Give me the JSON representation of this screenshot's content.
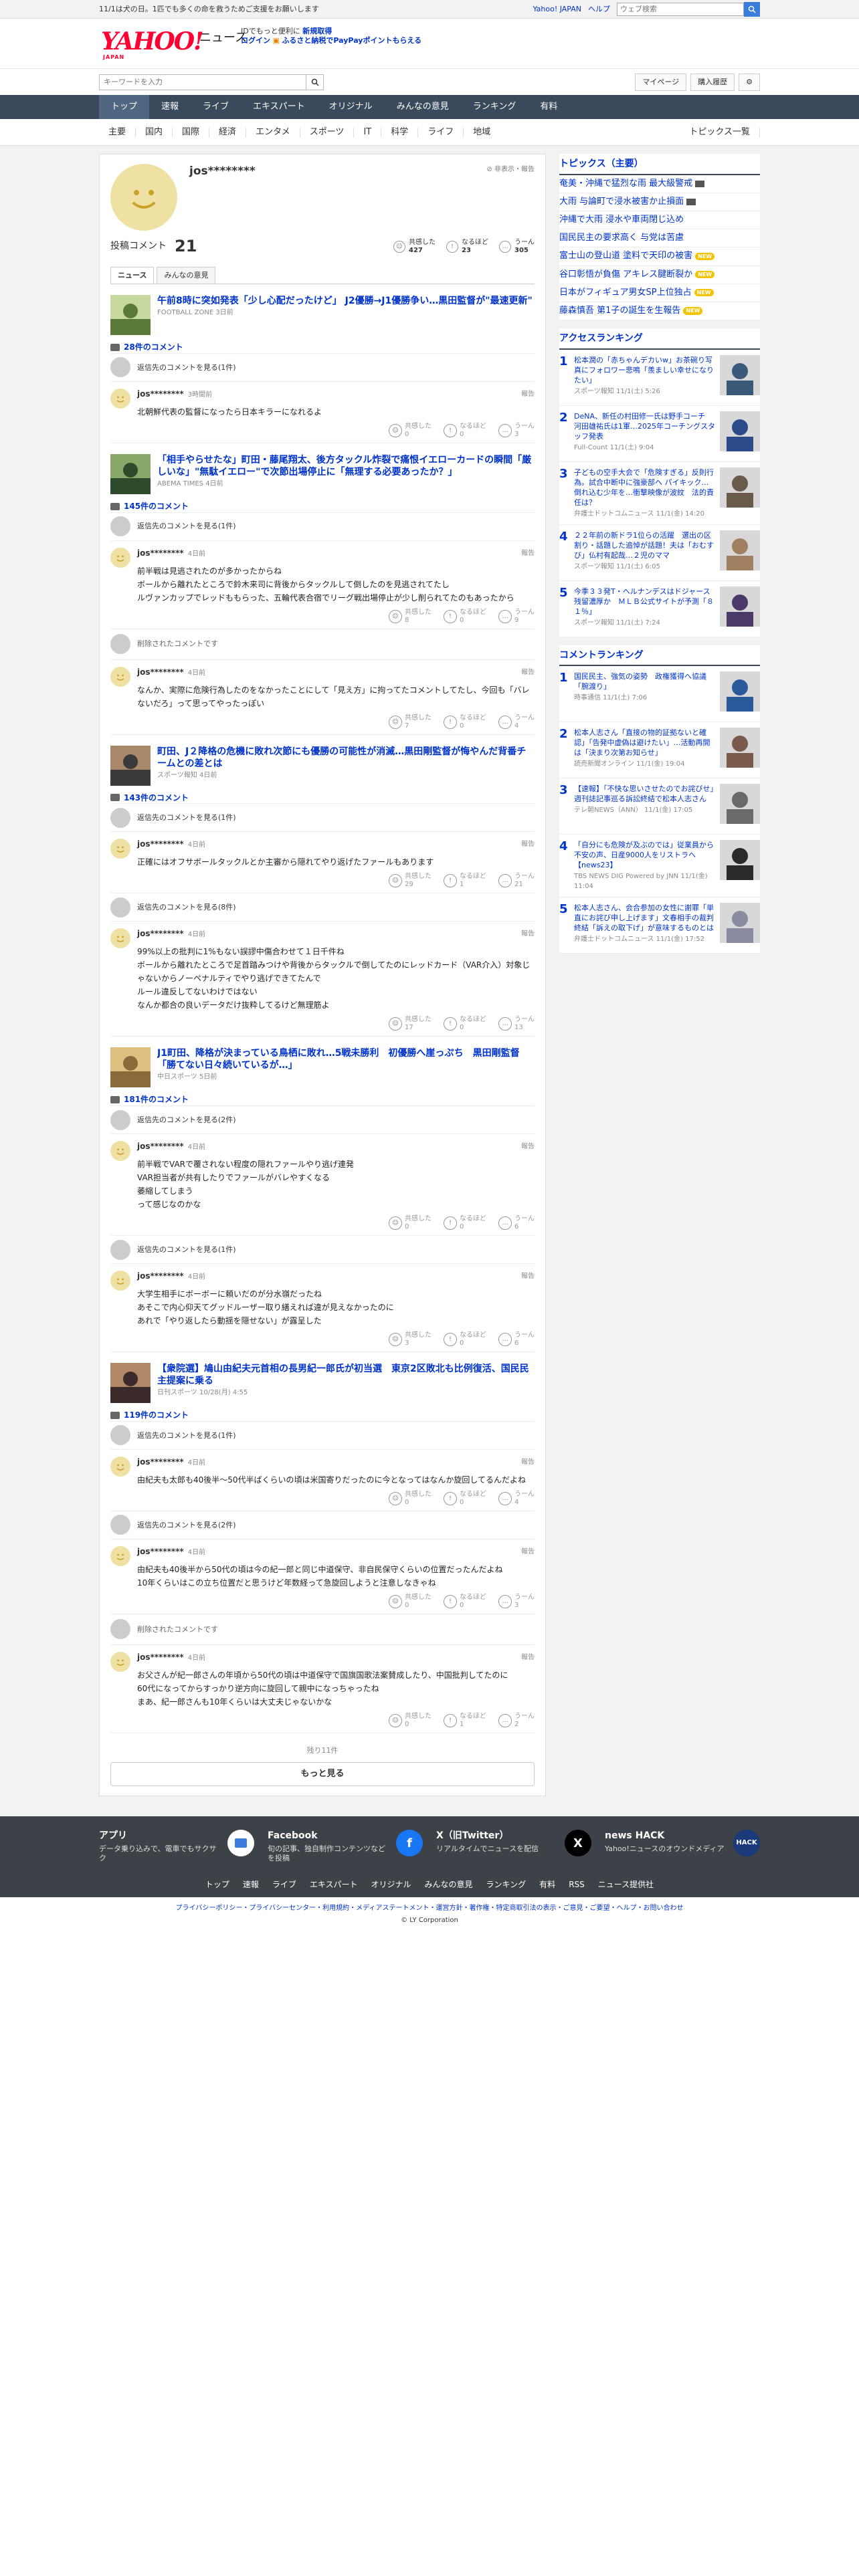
{
  "topbar": {
    "message": "11/1は犬の日。1匹でも多くの命を救うためご支援をお願いします",
    "links": [
      "Yahoo! JAPAN",
      "ヘルプ"
    ],
    "search_placeholder": "ウェブ検索"
  },
  "header": {
    "logo": "YAHOO!",
    "logo_sub": "JAPAN",
    "section": "ニュース",
    "promo_line1": "IDでもっと便利に",
    "promo_new": "新規取得",
    "promo_login": "ログイン",
    "promo_line2": "ふるさと納税でPayPayポイントもらえる",
    "search_placeholder": "キーワードを入力",
    "btn_mypage": "マイページ",
    "btn_purchase": "購入履歴"
  },
  "gnav": [
    "トップ",
    "速報",
    "ライブ",
    "エキスパート",
    "オリジナル",
    "みんなの意見",
    "ランキング",
    "有料"
  ],
  "snav": [
    "主要",
    "国内",
    "国際",
    "経済",
    "エンタメ",
    "スポーツ",
    "IT",
    "科学",
    "ライフ",
    "地域"
  ],
  "snav_right": "トピックス一覧",
  "profile": {
    "name": "jos********",
    "report": "非表示・報告",
    "count_label": "投稿コメント",
    "count": "21",
    "stats": [
      {
        "label": "共感した",
        "value": "427"
      },
      {
        "label": "なるほど",
        "value": "23"
      },
      {
        "label": "うーん",
        "value": "305"
      }
    ]
  },
  "tabs": [
    "ニュース",
    "みんなの意見"
  ],
  "reply_label": "返信先のコメントを見る(1件)",
  "deleted_label": "削除されたコメントです",
  "reactions": [
    "共感した",
    "なるほど",
    "うーん"
  ],
  "report_label": "報告",
  "articles": [
    {
      "title": "午前8時に突如発表「少し心配だったけど」 J2優勝→J1優勝争い…黒田監督が\"最速更新\"",
      "source": "FOOTBALL ZONE 3日前",
      "count": "28件のコメント",
      "reply": "返信先のコメントを見る(1件)",
      "comments": [
        {
          "user": "jos********",
          "time": "3時間前",
          "text": [
            "北朝鮮代表の監督になったら日本キラーになれるよ"
          ],
          "r": [
            "0",
            "0",
            "3"
          ]
        }
      ]
    },
    {
      "title": "「相手やらせたな」町田・藤尾翔太、後方タックル炸裂で痛恨イエローカードの瞬間「厳しいな」\"無駄イエロー\"で次節出場停止に「無理する必要あったか？」",
      "source": "ABEMA TIMES 4日前",
      "count": "145件のコメント",
      "reply": "返信先のコメントを見る(1件)",
      "comments": [
        {
          "user": "jos********",
          "time": "4日前",
          "text": [
            "前半戦は見逃されたのが多かったからね",
            "ボールから離れたところで鈴木来司に背後からタックルして倒したのを見逃されてたし",
            "ルヴァンカップでレッドももらった、五輪代表合宿でリーグ戦出場停止が少し削られてたのもあったから"
          ],
          "r": [
            "8",
            "0",
            "9"
          ],
          "deleted_before": false
        },
        {
          "user": "jos********",
          "time": "4日前",
          "text": [
            "なんか、実際に危険行為したのをなかったことにして「見え方」に拘ってたコメントしてたし、今回も「バレないだろ」って思ってやったっぽい"
          ],
          "r": [
            "7",
            "0",
            "4"
          ],
          "deleted_before": true
        }
      ]
    },
    {
      "title": "町田、J２降格の危機に敗れ次節にも優勝の可能性が消滅…黒田剛監督が悔やんだ背番チームとの差とは",
      "source": "スポーツ報知 4日前",
      "count": "143件のコメント",
      "reply": "返信先のコメントを見る(1件)",
      "comments": [
        {
          "user": "jos********",
          "time": "4日前",
          "text": [
            "正確にはオフサボールタックルとか主審から隠れてやり返げたファールもあります"
          ],
          "r": [
            "29",
            "1",
            "21"
          ]
        },
        {
          "user": "jos********",
          "time": "4日前",
          "reply_before": "返信先のコメントを見る(8件)",
          "text": [
            "99%以上の批判に1%もない誤謬中傷合わせて１日千件ね",
            "ボールから離れたところで足首踏みつけや背後からタックルで倒してたのにレッドカード（VAR介入）対象じゃないからノーペナルティでやり逃げできてたんで",
            "ルール違反してないわけではない",
            "なんか都合の良いデータだけ抜粋してるけど無理筋よ"
          ],
          "r": [
            "17",
            "0",
            "13"
          ]
        }
      ]
    },
    {
      "title": "J1町田、降格が決まっている鳥栖に敗れ…5戦未勝利　初優勝へ崖っぷち　黒田剛監督「勝てない日々続いているが…」",
      "source": "中日スポーツ 5日前",
      "count": "181件のコメント",
      "reply": "返信先のコメントを見る(2件)",
      "comments": [
        {
          "user": "jos********",
          "time": "4日前",
          "text": [
            "前半戦でVARで覆されない程度の隠れファールやり逃げ連発",
            "VAR担当者が共有したりでファールがバレやすくなる",
            "萎縮してしまう",
            "って感じなのかな"
          ],
          "r": [
            "0",
            "0",
            "6"
          ]
        },
        {
          "user": "jos********",
          "time": "4日前",
          "reply_before": "返信先のコメントを見る(1件)",
          "text": [
            "大学生相手にボーボーに頼いだのが分水嶺だったね",
            "あそこで内心仰天てグッドルーザー取り繕えれば違が見えなかったのに",
            "あれで「やり返したら動揺を隠せない」が露呈した"
          ],
          "r": [
            "3",
            "0",
            "6"
          ]
        }
      ]
    },
    {
      "title": "【衆院選】鳩山由紀夫元首相の長男紀一郎氏が初当選　東京2区敗北も比例復活、国民民主提案に乗る",
      "source": "日刊スポーツ 10/28(月) 4:55",
      "count": "119件のコメント",
      "reply": "返信先のコメントを見る(1件)",
      "comments": [
        {
          "user": "jos********",
          "time": "4日前",
          "text": [
            "由紀夫も太郎も40後半〜50代半ばくらいの頃は米国寄りだったのに今となってはなんか旋回してるんだよね"
          ],
          "r": [
            "0",
            "0",
            "4"
          ]
        },
        {
          "user": "jos********",
          "time": "4日前",
          "reply_before": "返信先のコメントを見る(2件)",
          "text": [
            "由紀夫も40後半から50代の頃は今の紀一郎と同じ中道保守、非自民保守くらいの位置だったんだよね",
            "10年くらいはこの立ち位置だと思うけど年数経って急旋回しようと注意しなきゃね"
          ],
          "r": [
            "0",
            "0",
            "3"
          ]
        },
        {
          "user": "jos********",
          "time": "4日前",
          "deleted_before": true,
          "text": [
            "お父さんが紀一郎さんの年頃から50代の頃は中道保守で国旗国歌法案賛成したり、中国批判してたのに",
            "60代になってからすっかり逆方向に旋回して親中になっちゃったね",
            "まあ、紀一郎さんも10年くらいは大丈夫じゃないかな"
          ],
          "r": [
            "0",
            "1",
            "2"
          ]
        }
      ]
    }
  ],
  "more": {
    "remaining": "残り11件",
    "button": "もっと見る"
  },
  "sidebar": {
    "topics_title": "トピックス（主要）",
    "topics": [
      {
        "t": "奄美・沖縄で猛烈な雨 最大級警戒",
        "b": "icon"
      },
      {
        "t": "大雨 与論町で浸水被害か止損面",
        "b": "icon"
      },
      {
        "t": "沖縄で大雨 浸水や車両閉じ込め",
        "b": ""
      },
      {
        "t": "国民民主の要求高く 与党は苦慮",
        "b": ""
      },
      {
        "t": "富士山の登山道 塗料で天印の被害",
        "b": "NEW"
      },
      {
        "t": "谷口彰悟が負傷 アキレス腱断裂か",
        "b": "NEW"
      },
      {
        "t": "日本がフィギュア男女SP上位独占",
        "b": "NEW"
      },
      {
        "t": "藤森慎吾 第1子の誕生を生報告",
        "b": "NEW"
      }
    ],
    "access_title": "アクセスランキング",
    "access": [
      {
        "t": "松本潤の「赤ちゃんデカいw」お茶碗り写真にフォロワー悲鳴「羨ましい幸せになりたい」",
        "s": "スポーツ報知 11/1(土) 5:26"
      },
      {
        "t": "DeNA、新任の村田修一氏は野手コーチ　河田雄祐氏は1軍…2025年コーチングスタッフ発表",
        "s": "Full-Count 11/1(土) 9:04"
      },
      {
        "t": "子どもの空手大会で「危険すぎる」反則行為。試合中断中に強豪部へ パイキック…倒れ込む少年を…衝撃映像が波紋　法的責任は？",
        "s": "弁護士ドットコムニュース 11/1(金) 14:20"
      },
      {
        "t": "２２年前の新ドラ1位らの活躍　選出の区割り・話題した追悼が話題！夫は「おむすび」仏村有起哉…２児のママ",
        "s": "スポーツ報知 11/1(土) 6:05"
      },
      {
        "t": "今季３３発T・ヘルナンデスはドジャース残留濃厚か　ＭＬＢ公式サイトが予測「８１％」",
        "s": "スポーツ報知 11/1(土) 7:24"
      }
    ],
    "comment_title": "コメントランキング",
    "comment_rank": [
      {
        "t": "国民民主、強気の姿勢　政権獲得へ協議「腕渡り」",
        "s": "時事通信 11/1(土) 7:06"
      },
      {
        "t": "松本人志さん「直接の物的証拠ないと確認」「告発中虚偽は避けたい」…活動再開は「決まり次第お知らせ」",
        "s": "読売新聞オンライン 11/1(金) 19:04"
      },
      {
        "t": "【速報】「不快な思いさせたのでお詫びせ」週刊誌記事巡る訴訟終結で松本人志さん",
        "s": "テレ朝NEWS（ANN） 11/1(金) 17:05"
      },
      {
        "t": "「自分にも危険が及ぶのでは」従業員から不安の声、日産9000人をリストラへ【news23】",
        "s": "TBS NEWS DIG Powered by JNN 11/1(金) 11:04"
      },
      {
        "t": "松本人志さん、会合参加の女性に謝罪「単直にお詫び申し上げます」文春相手の裁判終結「訴えの取下げ」が意味するものとは",
        "s": "弁護士ドットコムニュース 11/1(金) 17:52"
      }
    ]
  },
  "footer": {
    "cols": [
      {
        "title": "アプリ",
        "desc": "データ乗り込みで、電車でもサクサク",
        "icon": "app-icon"
      },
      {
        "title": "Facebook",
        "desc": "旬の記事、独自制作コンテンツなどを投稿",
        "icon": "f"
      },
      {
        "title": "X（旧Twitter）",
        "desc": "リアルタイムでニュースを配信",
        "icon": "X"
      },
      {
        "title": "news HACK",
        "desc": "Yahoo!ニュースのオウンドメディア",
        "icon": "HACK"
      }
    ],
    "nav": [
      "トップ",
      "速報",
      "ライブ",
      "エキスパート",
      "オリジナル",
      "みんなの意見",
      "ランキング",
      "有料",
      "RSS",
      "ニュース提供社"
    ],
    "legal": "プライバシーポリシー・プライバシーセンター・利用規約・メディアステートメント・運営方針・著作権・特定商取引法の表示・ご意見・ご要望・ヘルプ・お問い合わせ",
    "copyright": "© LY Corporation"
  },
  "colors": {
    "brand": "#ff0033",
    "link": "#0033cc",
    "nav": "#3a4a5c",
    "footer": "#3c4248"
  }
}
